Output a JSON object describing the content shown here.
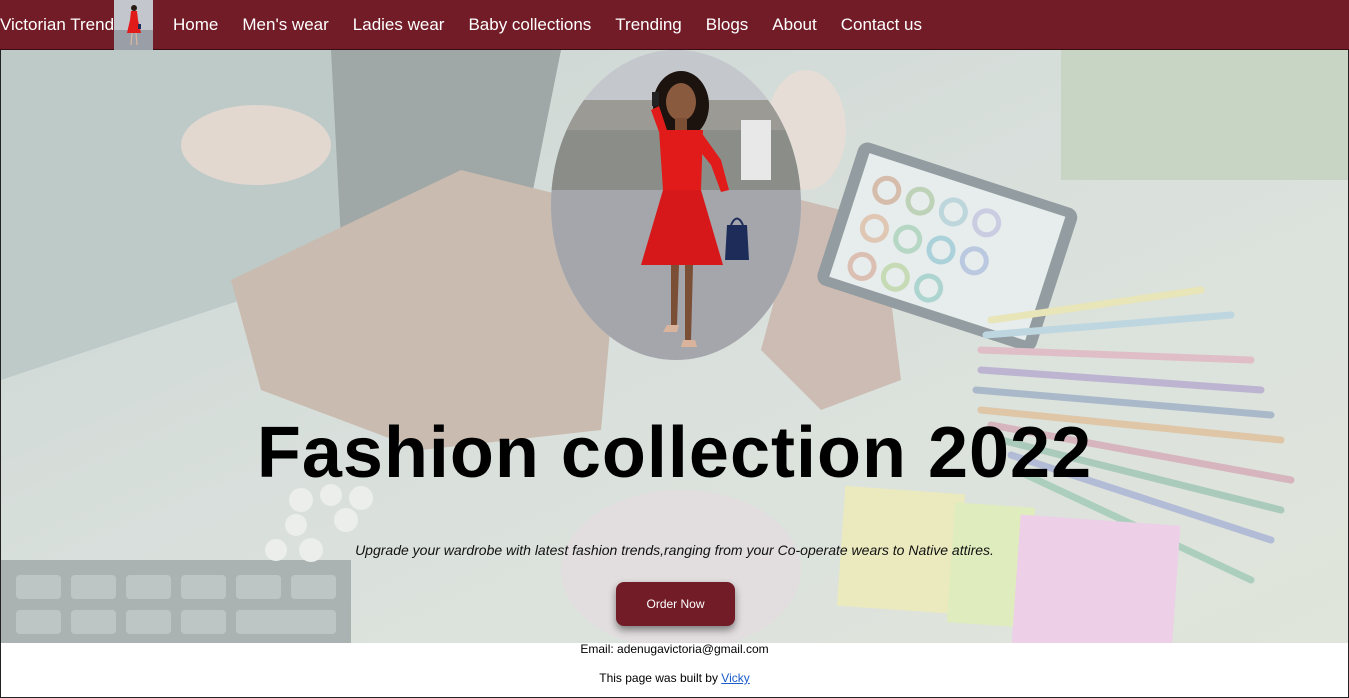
{
  "navbar": {
    "brand": "Victorian Trend",
    "items": [
      {
        "label": "Home"
      },
      {
        "label": "Men's wear"
      },
      {
        "label": "Ladies wear"
      },
      {
        "label": "Baby collections"
      },
      {
        "label": "Trending"
      },
      {
        "label": "Blogs"
      },
      {
        "label": "About"
      },
      {
        "label": "Contact us"
      }
    ]
  },
  "hero": {
    "title": "Fashion collection 2022",
    "subtitle": "Upgrade your wardrobe with latest fashion trends,ranging from your Co-operate wears to Native attires.",
    "button_label": "Order Now"
  },
  "footer": {
    "email_text": "Email: adenugavictoria@gmail.com",
    "built_text": "This page was built by",
    "built_link": "Vicky"
  },
  "colors": {
    "brand": "#711c27",
    "link": "#1a5cc8",
    "dress": "#e11a1a"
  }
}
